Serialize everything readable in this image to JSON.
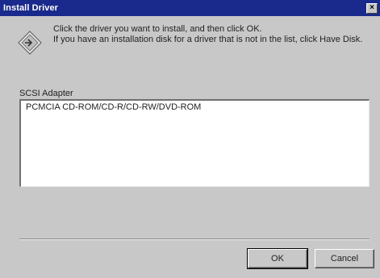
{
  "window": {
    "title": "Install Driver",
    "close_glyph": "×"
  },
  "instructions": {
    "line1": "Click the driver you want to install, and then click OK.",
    "line2": "If you have an installation disk for a driver that is not in the list, click Have Disk."
  },
  "icon": "install-driver-icon",
  "list": {
    "label": "SCSI Adapter",
    "items": [
      "PCMCIA CD-ROM/CD-R/CD-RW/DVD-ROM"
    ]
  },
  "buttons": {
    "ok": "OK",
    "cancel": "Cancel"
  },
  "colors": {
    "titlebar": "#1a2a8c",
    "face": "#c8c8c8"
  }
}
